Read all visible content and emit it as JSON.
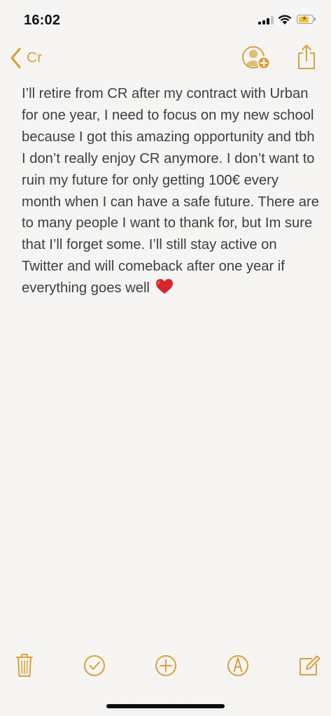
{
  "status_bar": {
    "time": "16:02",
    "signal_bars_active": 3,
    "signal_bars_total": 4,
    "battery_level": 0.75,
    "charging": true
  },
  "nav": {
    "back_label": "Cr",
    "back_icon": "chevron-left-icon",
    "add_people_icon": "add-person-icon",
    "share_icon": "share-icon"
  },
  "note": {
    "text": "I’ll retire from CR after my contract with Urban for one year, I need to focus on my new school because I got this amazing opportunity and tbh I don’t really enjoy CR anymore. I don’t want to ruin my future for only getting 100€ every month when I can have a safe future. There are to many people I want to thank for, but Im sure that I’ll forget some. I’ll still stay active on Twitter and will comeback after one year if everything goes well",
    "trailing_emoji": "heart-emoji"
  },
  "toolbar": {
    "items": [
      "trash-icon",
      "checklist-icon",
      "add-icon",
      "markup-icon",
      "compose-icon"
    ]
  },
  "colors": {
    "accent": "#d8a13a",
    "text": "#3e3e3e",
    "background": "#f7f6f4",
    "heart": "#d6262e"
  }
}
